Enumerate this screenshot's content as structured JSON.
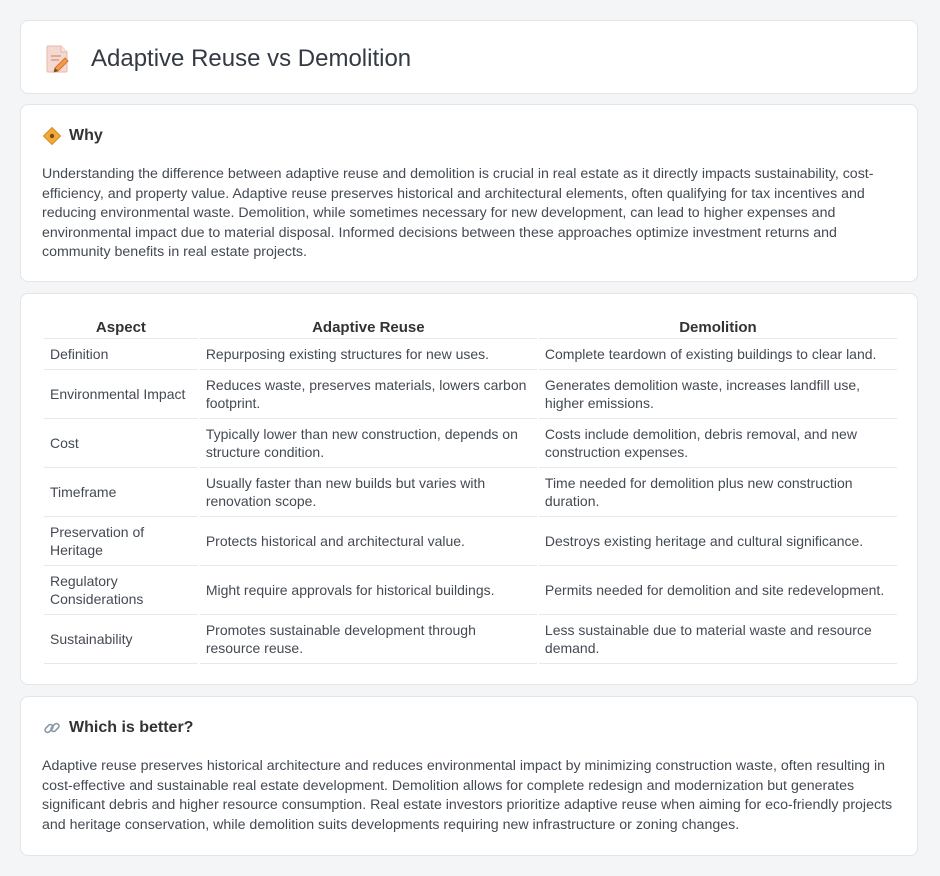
{
  "header": {
    "title": "Adaptive Reuse vs Demolition",
    "icon": "document-pencil-icon"
  },
  "why": {
    "title": "Why",
    "icon": "diamond-sign-icon",
    "text": "Understanding the difference between adaptive reuse and demolition is crucial in real estate as it directly impacts sustainability, cost-efficiency, and property value. Adaptive reuse preserves historical and architectural elements, often qualifying for tax incentives and reducing environmental waste. Demolition, while sometimes necessary for new development, can lead to higher expenses and environmental impact due to material disposal. Informed decisions between these approaches optimize investment returns and community benefits in real estate projects."
  },
  "table": {
    "headers": [
      "Aspect",
      "Adaptive Reuse",
      "Demolition"
    ],
    "rows": [
      [
        "Definition",
        "Repurposing existing structures for new uses.",
        "Complete teardown of existing buildings to clear land."
      ],
      [
        "Environmental Impact",
        "Reduces waste, preserves materials, lowers carbon footprint.",
        "Generates demolition waste, increases landfill use, higher emissions."
      ],
      [
        "Cost",
        "Typically lower than new construction, depends on structure condition.",
        "Costs include demolition, debris removal, and new construction expenses."
      ],
      [
        "Timeframe",
        "Usually faster than new builds but varies with renovation scope.",
        "Time needed for demolition plus new construction duration."
      ],
      [
        "Preservation of Heritage",
        "Protects historical and architectural value.",
        "Destroys existing heritage and cultural significance."
      ],
      [
        "Regulatory Considerations",
        "Might require approvals for historical buildings.",
        "Permits needed for demolition and site redevelopment."
      ],
      [
        "Sustainability",
        "Promotes sustainable development through resource reuse.",
        "Less sustainable due to material waste and resource demand."
      ]
    ]
  },
  "better": {
    "title": "Which is better?",
    "icon": "link-icon",
    "text": "Adaptive reuse preserves historical architecture and reduces environmental impact by minimizing construction waste, often resulting in cost-effective and sustainable real estate development. Demolition allows for complete redesign and modernization but generates significant debris and higher resource consumption. Real estate investors prioritize adaptive reuse when aiming for eco-friendly projects and heritage conservation, while demolition suits developments requiring new infrastructure or zoning changes."
  },
  "colors": {
    "background": "#f4f5f7",
    "card": "#ffffff",
    "border": "#e3e5e8",
    "accent_orange": "#f2994a"
  }
}
